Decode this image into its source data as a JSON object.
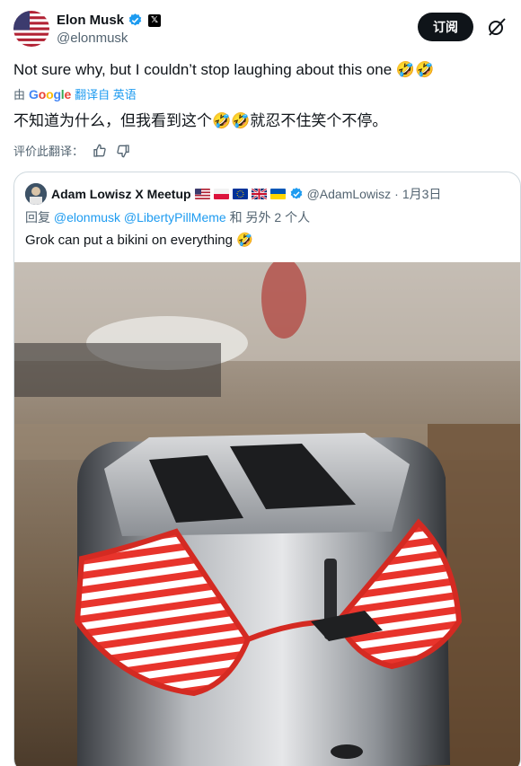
{
  "author": {
    "name": "Elon Musk",
    "handle": "@elonmusk"
  },
  "actions": {
    "subscribe_label": "订阅"
  },
  "tweet": {
    "text": "Not sure why, but I couldn’t stop laughing about this one 🤣🤣",
    "translate_prefix": "由",
    "translate_provider": "Google",
    "translate_label": "翻译自 英语",
    "translated_text": "不知道为什么，但我看到这个🤣🤣就忍不住笑个不停。",
    "rate_label": "评价此翻译："
  },
  "quote": {
    "author_name": "Adam Lowisz X Meetup",
    "handle": "@AdamLowisz",
    "separator": "·",
    "date": "1月3日",
    "reply_prefix": "回复",
    "reply_users": "@elonmusk @LibertyPillMeme",
    "reply_suffix": "和 另外 2 个人",
    "text": "Grok can put a bikini on everything 🤣",
    "image_alt": "toaster wearing a red and white striped bikini top"
  },
  "icons": [
    "verified-badge-icon",
    "x-logo-icon",
    "grok-icon",
    "thumbs-up-icon",
    "thumbs-down-icon"
  ],
  "colors": {
    "accent": "#1d9bf0",
    "text": "#0f1419",
    "muted": "#536471",
    "subscribe_bg": "#0f1419"
  }
}
